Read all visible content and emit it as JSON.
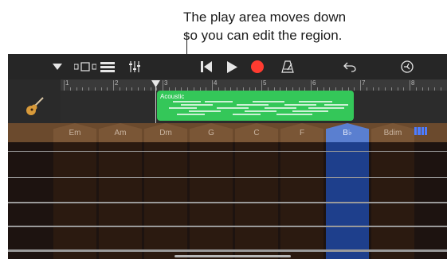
{
  "callout": {
    "line1": "The play area moves down",
    "line2": "so you can edit the region."
  },
  "toolbar": {
    "icons": [
      "dropdown-icon",
      "view-toggle-icon",
      "tracks-view-icon",
      "mixer-icon",
      "go-to-beginning-icon",
      "play-icon",
      "record-icon",
      "metronome-icon",
      "undo-icon",
      "settings-icon"
    ],
    "record_color": "#ff3b30"
  },
  "ruler": {
    "bars": [
      "1",
      "2",
      "3",
      "4",
      "5",
      "6",
      "7",
      "8"
    ]
  },
  "track": {
    "instrument_icon": "acoustic-guitar-icon",
    "region_name": "Acoustic",
    "region_color": "#34c759"
  },
  "chords": [
    "Em",
    "Am",
    "Dm",
    "G",
    "C",
    "F",
    "B♭",
    "Bdim"
  ],
  "selected_chord": "B♭",
  "accent": "#4d7cff"
}
